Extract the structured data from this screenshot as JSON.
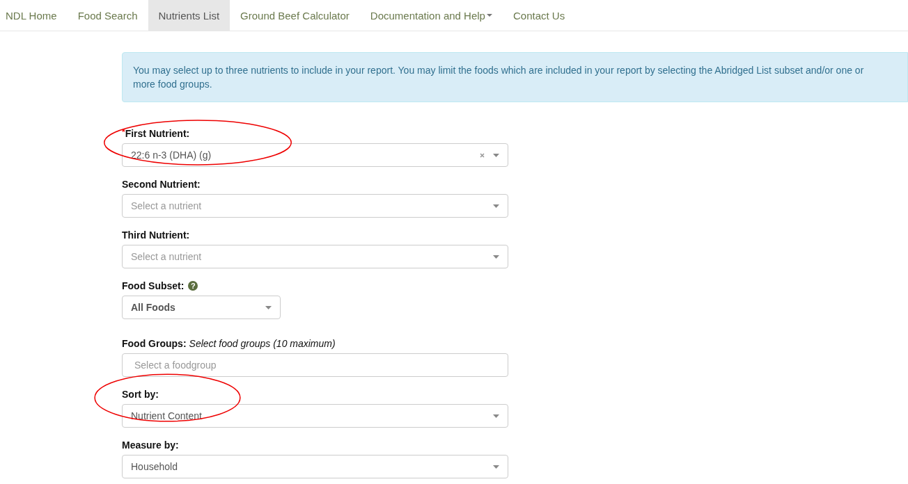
{
  "nav": [
    {
      "label": "NDL Home",
      "selected": false,
      "dropdown": false
    },
    {
      "label": "Food Search",
      "selected": false,
      "dropdown": false
    },
    {
      "label": "Nutrients List",
      "selected": true,
      "dropdown": false
    },
    {
      "label": "Ground Beef Calculator",
      "selected": false,
      "dropdown": false
    },
    {
      "label": "Documentation and Help",
      "selected": false,
      "dropdown": true
    },
    {
      "label": "Contact Us",
      "selected": false,
      "dropdown": false
    }
  ],
  "alert": "You may select up to three nutrients to include in your report. You may limit the foods which are included in your report by selecting the Abridged List subset and/or one or more food groups.",
  "fields": [
    {
      "kind": "select",
      "label": "First Nutrient:",
      "required_mark": "*",
      "value": "22:6 n-3 (DHA) (g)",
      "clearable": true,
      "circled": true
    },
    {
      "kind": "select",
      "label": "Second Nutrient:",
      "placeholder": "Select a nutrient",
      "clearable": false,
      "circled": false
    },
    {
      "kind": "select",
      "label": "Third Nutrient:",
      "placeholder": "Select a nutrient",
      "clearable": false,
      "circled": false
    },
    {
      "kind": "subset",
      "label": "Food Subset:",
      "value": "All Foods",
      "help": "?",
      "circled": false
    },
    {
      "kind": "multi",
      "label": "Food Groups:",
      "hint": "Select food groups (10 maximum)",
      "placeholder": "Select a foodgroup",
      "circled": false
    },
    {
      "kind": "select",
      "label": "Sort by:",
      "value": "Nutrient Content",
      "clearable": false,
      "circled": true
    },
    {
      "kind": "select",
      "label": "Measure by:",
      "value": "Household",
      "clearable": false,
      "circled": false
    }
  ]
}
